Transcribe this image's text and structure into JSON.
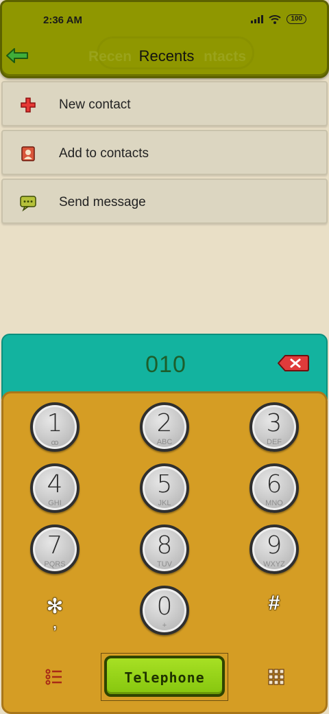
{
  "status_bar": {
    "time": "2:36 AM",
    "battery": "100"
  },
  "header": {
    "title": "Recents",
    "ghost_left": "Recen",
    "ghost_right": "ntacts"
  },
  "menu": [
    {
      "label": "New contact",
      "icon": "plus-icon"
    },
    {
      "label": "Add to contacts",
      "icon": "contact-card-icon"
    },
    {
      "label": "Send message",
      "icon": "message-icon"
    }
  ],
  "dialer": {
    "number": "010",
    "keys": [
      {
        "digit": "1",
        "letters": "ꝏ"
      },
      {
        "digit": "2",
        "letters": "ABC"
      },
      {
        "digit": "3",
        "letters": "DEF"
      },
      {
        "digit": "4",
        "letters": "GHI"
      },
      {
        "digit": "5",
        "letters": "JKL"
      },
      {
        "digit": "6",
        "letters": "MNO"
      },
      {
        "digit": "7",
        "letters": "PQRS"
      },
      {
        "digit": "8",
        "letters": "TUV"
      },
      {
        "digit": "9",
        "letters": "WXYZ"
      },
      {
        "digit": "0",
        "letters": "+"
      }
    ],
    "star": "✻",
    "star_sub": ",",
    "hash": "#",
    "call_label": "Telephone"
  },
  "colors": {
    "header": "#8f9700",
    "number_bar": "#13b39f",
    "keypad": "#d59d24",
    "call_button": "#9ad51a"
  }
}
